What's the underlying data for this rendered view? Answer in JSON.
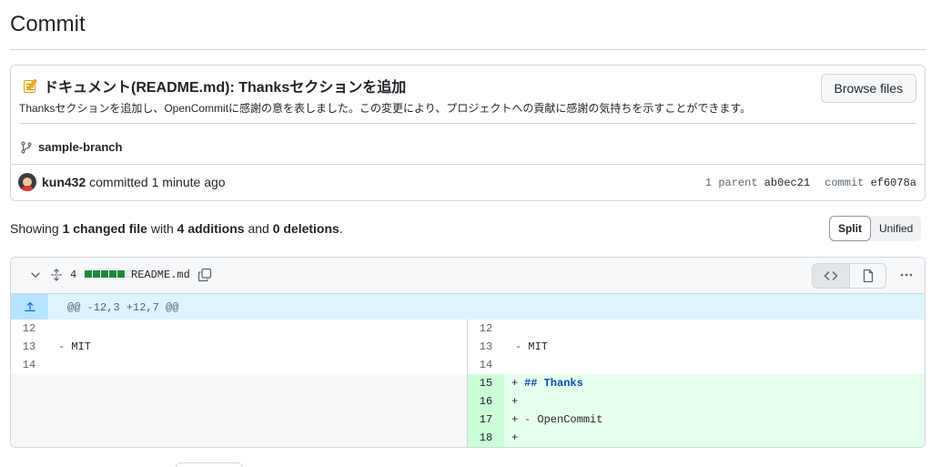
{
  "page": {
    "title": "Commit"
  },
  "commit": {
    "emoji": "memo-icon",
    "title": "ドキュメント(README.md): Thanksセクションを追加",
    "description": "Thanksセクションを追加し、OpenCommitに感謝の意を表しました。この変更により、プロジェクトへの貢献に感謝の気持ちを示すことができます。",
    "browse_label": "Browse files",
    "branch": "sample-branch",
    "author": "kun432",
    "action": "committed",
    "time": "1 minute ago",
    "parent_label": "1 parent",
    "parent_sha": "ab0ec21",
    "commit_label": "commit",
    "commit_sha": "ef6078a"
  },
  "summary": {
    "prefix": "Showing",
    "files": "1 changed file",
    "with": "with",
    "additions": "4 additions",
    "and": "and",
    "deletions": "0 deletions",
    "suffix": "."
  },
  "view_toggle": {
    "split": "Split",
    "unified": "Unified",
    "active": "split"
  },
  "diff": {
    "change_count": "4",
    "bar": {
      "additions": 5,
      "neutral": 1
    },
    "filename": "README.md",
    "hunk_header": "@@ -12,3 +12,7 @@",
    "left_lines": [
      {
        "num": "12",
        "text": ""
      },
      {
        "num": "13",
        "text": "- MIT"
      },
      {
        "num": "14",
        "text": ""
      }
    ],
    "right_lines": [
      {
        "num": "12",
        "text": "",
        "type": "context"
      },
      {
        "num": "13",
        "text": "- MIT",
        "type": "context"
      },
      {
        "num": "14",
        "text": "",
        "type": "context"
      },
      {
        "num": "15",
        "text": "## Thanks",
        "type": "add"
      },
      {
        "num": "16",
        "text": "",
        "type": "add"
      },
      {
        "num": "17",
        "text": "- OpenCommit",
        "type": "add"
      },
      {
        "num": "18",
        "text": "",
        "type": "add"
      }
    ],
    "colors": {
      "add_bg": "#e6ffec",
      "add_gutter": "#ccffd8",
      "hunk_bg": "#ddf4ff"
    }
  }
}
